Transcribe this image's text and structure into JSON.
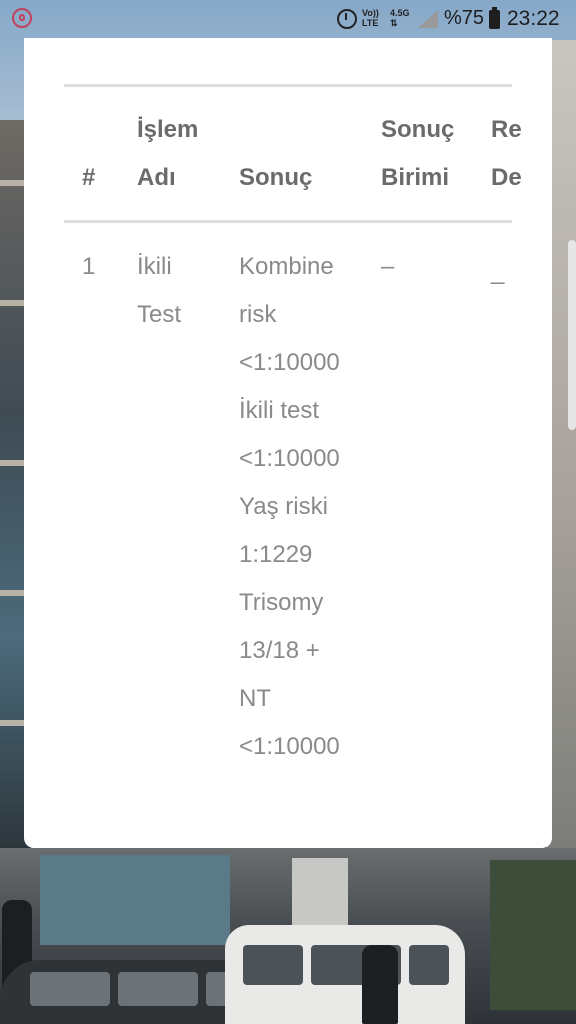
{
  "status_bar": {
    "app_icon": "baby-app-icon",
    "alarm_icon": "alarm-clock-icon",
    "volte_label": [
      "Vo))",
      "LTE"
    ],
    "network_label": [
      "4.5G",
      "⇅"
    ],
    "signal_icon": "signal-icon",
    "battery_percent": "%75",
    "battery_icon": "battery-icon",
    "time": "23:22"
  },
  "table": {
    "headers": {
      "index": "#",
      "name_line1": "İşlem",
      "name_line2": "Adı",
      "result": "Sonuç",
      "unit_line1": "Sonuç",
      "unit_line2": "Birimi",
      "ref_line1": "Re",
      "ref_line2": "De"
    },
    "rows": [
      {
        "index": "1",
        "name_line1": "İkili",
        "name_line2": "Test",
        "result_lines": [
          "Kombine",
          "risk",
          "<1:10000",
          "İkili test",
          "<1:10000",
          "Yaş riski",
          "1:1229",
          "Trisomy",
          "13/18 +",
          "NT",
          "<1:10000"
        ],
        "unit": "–",
        "ref": "_"
      }
    ]
  },
  "colors": {
    "header_text": "#6b6b6b",
    "cell_text": "#8a8a8a",
    "divider": "#dedede",
    "card_background": "#ffffff"
  }
}
